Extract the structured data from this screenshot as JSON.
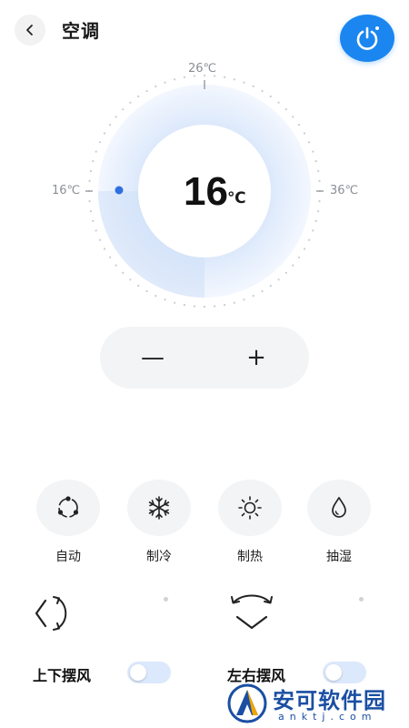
{
  "header": {
    "back_icon": "chevron-left-icon",
    "title": "空调",
    "power_icon": "power-icon",
    "power_color": "#1b86f0"
  },
  "dial": {
    "current_temp": "16",
    "unit": "℃",
    "min_label": "16℃",
    "mid_label": "26℃",
    "max_label": "36℃",
    "min": 16,
    "max": 36,
    "value": 16,
    "accent_color": "#2f6fe0",
    "track_color": "#e6f0fd"
  },
  "stepper": {
    "minus_label": "—",
    "plus_label": "+"
  },
  "modes": [
    {
      "label": "自动",
      "icon": "cycle-icon"
    },
    {
      "label": "制冷",
      "icon": "snowflake-icon"
    },
    {
      "label": "制热",
      "icon": "sun-icon"
    },
    {
      "label": "抽湿",
      "icon": "droplet-icon"
    }
  ],
  "swing": [
    {
      "label": "上下摆风",
      "icon": "vertical-swing-icon",
      "enabled": false
    },
    {
      "label": "左右摆风",
      "icon": "horizontal-swing-icon",
      "enabled": false
    }
  ],
  "watermark": {
    "title": "安可软件园",
    "subtitle": "anktj.com"
  }
}
